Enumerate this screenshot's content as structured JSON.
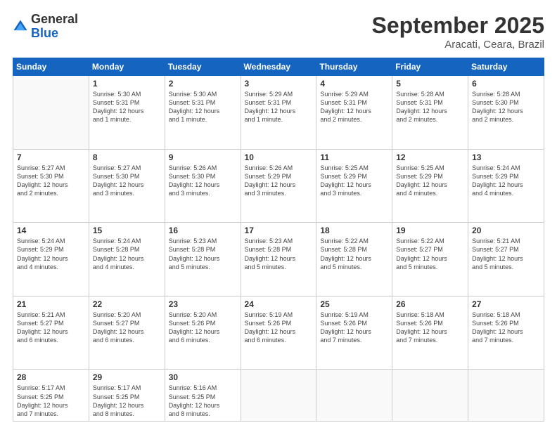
{
  "header": {
    "logo": {
      "line1": "General",
      "line2": "Blue"
    },
    "title": "September 2025",
    "location": "Aracati, Ceara, Brazil"
  },
  "weekdays": [
    "Sunday",
    "Monday",
    "Tuesday",
    "Wednesday",
    "Thursday",
    "Friday",
    "Saturday"
  ],
  "weeks": [
    [
      {
        "day": "",
        "info": ""
      },
      {
        "day": "1",
        "info": "Sunrise: 5:30 AM\nSunset: 5:31 PM\nDaylight: 12 hours\nand 1 minute."
      },
      {
        "day": "2",
        "info": "Sunrise: 5:30 AM\nSunset: 5:31 PM\nDaylight: 12 hours\nand 1 minute."
      },
      {
        "day": "3",
        "info": "Sunrise: 5:29 AM\nSunset: 5:31 PM\nDaylight: 12 hours\nand 1 minute."
      },
      {
        "day": "4",
        "info": "Sunrise: 5:29 AM\nSunset: 5:31 PM\nDaylight: 12 hours\nand 2 minutes."
      },
      {
        "day": "5",
        "info": "Sunrise: 5:28 AM\nSunset: 5:31 PM\nDaylight: 12 hours\nand 2 minutes."
      },
      {
        "day": "6",
        "info": "Sunrise: 5:28 AM\nSunset: 5:30 PM\nDaylight: 12 hours\nand 2 minutes."
      }
    ],
    [
      {
        "day": "7",
        "info": "Sunrise: 5:27 AM\nSunset: 5:30 PM\nDaylight: 12 hours\nand 2 minutes."
      },
      {
        "day": "8",
        "info": "Sunrise: 5:27 AM\nSunset: 5:30 PM\nDaylight: 12 hours\nand 3 minutes."
      },
      {
        "day": "9",
        "info": "Sunrise: 5:26 AM\nSunset: 5:30 PM\nDaylight: 12 hours\nand 3 minutes."
      },
      {
        "day": "10",
        "info": "Sunrise: 5:26 AM\nSunset: 5:29 PM\nDaylight: 12 hours\nand 3 minutes."
      },
      {
        "day": "11",
        "info": "Sunrise: 5:25 AM\nSunset: 5:29 PM\nDaylight: 12 hours\nand 3 minutes."
      },
      {
        "day": "12",
        "info": "Sunrise: 5:25 AM\nSunset: 5:29 PM\nDaylight: 12 hours\nand 4 minutes."
      },
      {
        "day": "13",
        "info": "Sunrise: 5:24 AM\nSunset: 5:29 PM\nDaylight: 12 hours\nand 4 minutes."
      }
    ],
    [
      {
        "day": "14",
        "info": "Sunrise: 5:24 AM\nSunset: 5:29 PM\nDaylight: 12 hours\nand 4 minutes."
      },
      {
        "day": "15",
        "info": "Sunrise: 5:24 AM\nSunset: 5:28 PM\nDaylight: 12 hours\nand 4 minutes."
      },
      {
        "day": "16",
        "info": "Sunrise: 5:23 AM\nSunset: 5:28 PM\nDaylight: 12 hours\nand 5 minutes."
      },
      {
        "day": "17",
        "info": "Sunrise: 5:23 AM\nSunset: 5:28 PM\nDaylight: 12 hours\nand 5 minutes."
      },
      {
        "day": "18",
        "info": "Sunrise: 5:22 AM\nSunset: 5:28 PM\nDaylight: 12 hours\nand 5 minutes."
      },
      {
        "day": "19",
        "info": "Sunrise: 5:22 AM\nSunset: 5:27 PM\nDaylight: 12 hours\nand 5 minutes."
      },
      {
        "day": "20",
        "info": "Sunrise: 5:21 AM\nSunset: 5:27 PM\nDaylight: 12 hours\nand 5 minutes."
      }
    ],
    [
      {
        "day": "21",
        "info": "Sunrise: 5:21 AM\nSunset: 5:27 PM\nDaylight: 12 hours\nand 6 minutes."
      },
      {
        "day": "22",
        "info": "Sunrise: 5:20 AM\nSunset: 5:27 PM\nDaylight: 12 hours\nand 6 minutes."
      },
      {
        "day": "23",
        "info": "Sunrise: 5:20 AM\nSunset: 5:26 PM\nDaylight: 12 hours\nand 6 minutes."
      },
      {
        "day": "24",
        "info": "Sunrise: 5:19 AM\nSunset: 5:26 PM\nDaylight: 12 hours\nand 6 minutes."
      },
      {
        "day": "25",
        "info": "Sunrise: 5:19 AM\nSunset: 5:26 PM\nDaylight: 12 hours\nand 7 minutes."
      },
      {
        "day": "26",
        "info": "Sunrise: 5:18 AM\nSunset: 5:26 PM\nDaylight: 12 hours\nand 7 minutes."
      },
      {
        "day": "27",
        "info": "Sunrise: 5:18 AM\nSunset: 5:26 PM\nDaylight: 12 hours\nand 7 minutes."
      }
    ],
    [
      {
        "day": "28",
        "info": "Sunrise: 5:17 AM\nSunset: 5:25 PM\nDaylight: 12 hours\nand 7 minutes."
      },
      {
        "day": "29",
        "info": "Sunrise: 5:17 AM\nSunset: 5:25 PM\nDaylight: 12 hours\nand 8 minutes."
      },
      {
        "day": "30",
        "info": "Sunrise: 5:16 AM\nSunset: 5:25 PM\nDaylight: 12 hours\nand 8 minutes."
      },
      {
        "day": "",
        "info": ""
      },
      {
        "day": "",
        "info": ""
      },
      {
        "day": "",
        "info": ""
      },
      {
        "day": "",
        "info": ""
      }
    ]
  ]
}
